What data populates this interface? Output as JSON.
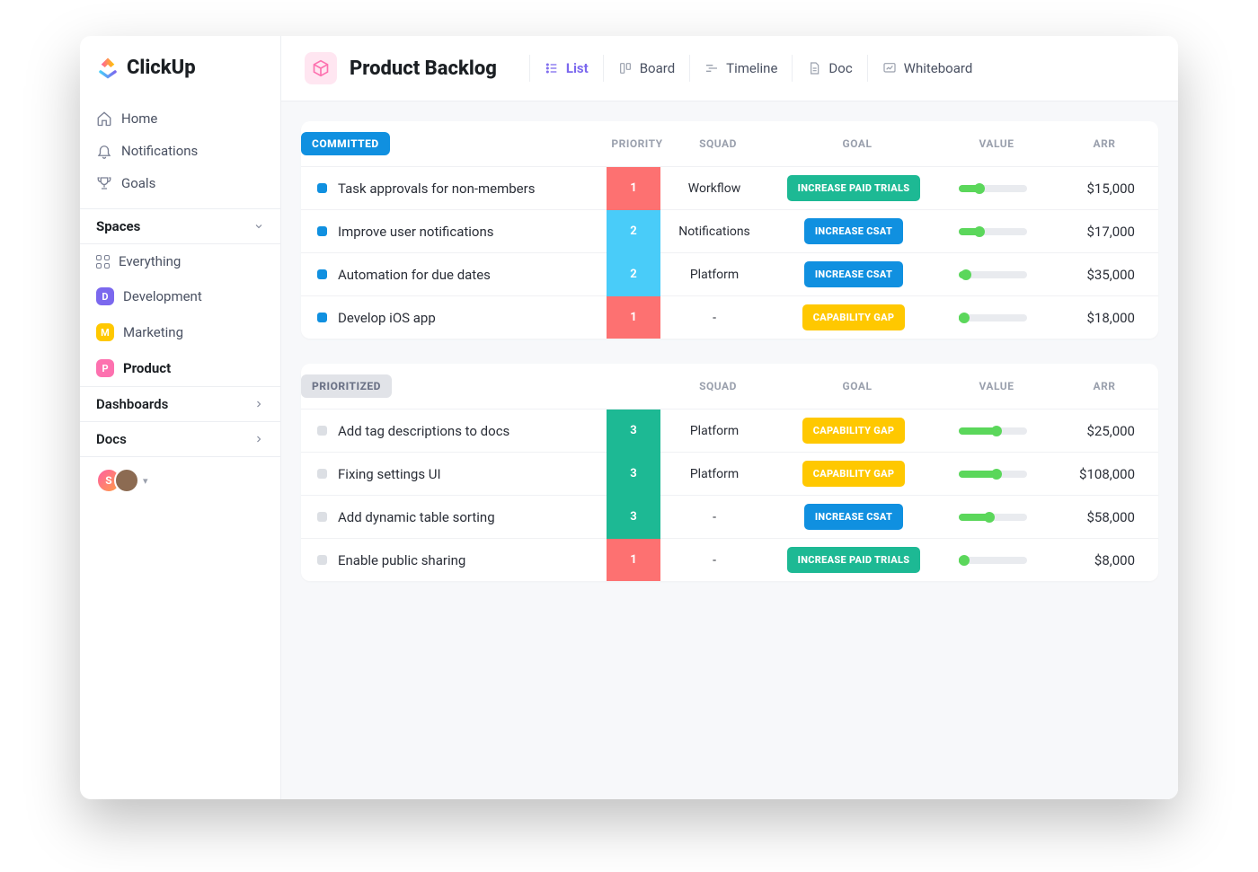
{
  "brand": "ClickUp",
  "sidebar": {
    "nav": [
      {
        "icon": "home",
        "label": "Home"
      },
      {
        "icon": "bell",
        "label": "Notifications"
      },
      {
        "icon": "trophy",
        "label": "Goals"
      }
    ],
    "spaces_header": "Spaces",
    "everything": "Everything",
    "spaces": [
      {
        "letter": "D",
        "color": "#7b68ee",
        "label": "Development",
        "active": false
      },
      {
        "letter": "M",
        "color": "#ffc800",
        "label": "Marketing",
        "active": false
      },
      {
        "letter": "P",
        "color": "#fd71af",
        "label": "Product",
        "active": true
      }
    ],
    "dashboards": "Dashboards",
    "docs": "Docs",
    "avatars": [
      {
        "letter": "S",
        "bg": "linear-gradient(135deg,#ff5ea3,#ff9f46)"
      },
      {
        "letter": "",
        "bg": "#8c6b52"
      }
    ]
  },
  "header": {
    "page_title": "Product Backlog",
    "views": [
      {
        "icon": "list",
        "label": "List",
        "active": true
      },
      {
        "icon": "board",
        "label": "Board",
        "active": false
      },
      {
        "icon": "timeline",
        "label": "Timeline",
        "active": false
      },
      {
        "icon": "doc",
        "label": "Doc",
        "active": false
      },
      {
        "icon": "whiteboard",
        "label": "Whiteboard",
        "active": false
      }
    ]
  },
  "columns": {
    "priority": "PRIORITY",
    "squad": "SQUAD",
    "goal": "GOAL",
    "value": "VALUE",
    "arr": "ARR"
  },
  "priority_colors": {
    "1": "#fd7171",
    "2": "#49ccf9",
    "3": "#1db994"
  },
  "goal_colors": {
    "INCREASE PAID TRIALS": "#1db994",
    "INCREASE CSAT": "#1090e0",
    "CAPABILITY GAP": "#ffc800"
  },
  "groups": [
    {
      "name": "COMMITTED",
      "badge": "blue",
      "show_priority_header": true,
      "tasks": [
        {
          "marker": "#1090e0",
          "title": "Task approvals for non-members",
          "priority": "1",
          "squad": "Workflow",
          "goal": "INCREASE PAID TRIALS",
          "value": 30,
          "arr": "$15,000"
        },
        {
          "marker": "#1090e0",
          "title": "Improve  user notifications",
          "priority": "2",
          "squad": "Notifications",
          "goal": "INCREASE CSAT",
          "value": 30,
          "arr": "$17,000"
        },
        {
          "marker": "#1090e0",
          "title": "Automation for due dates",
          "priority": "2",
          "squad": "Platform",
          "goal": "INCREASE CSAT",
          "value": 10,
          "arr": "$35,000"
        },
        {
          "marker": "#1090e0",
          "title": "Develop iOS app",
          "priority": "1",
          "squad": "-",
          "goal": "CAPABILITY GAP",
          "value": 8,
          "arr": "$18,000"
        }
      ]
    },
    {
      "name": "PRIORITIZED",
      "badge": "gray",
      "show_priority_header": false,
      "tasks": [
        {
          "marker": "#dcdfe4",
          "title": "Add tag descriptions to docs",
          "priority": "3",
          "squad": "Platform",
          "goal": "CAPABILITY GAP",
          "value": 55,
          "arr": "$25,000"
        },
        {
          "marker": "#dcdfe4",
          "title": "Fixing settings UI",
          "priority": "3",
          "squad": "Platform",
          "goal": "CAPABILITY GAP",
          "value": 55,
          "arr": "$108,000"
        },
        {
          "marker": "#dcdfe4",
          "title": "Add dynamic table sorting",
          "priority": "3",
          "squad": "-",
          "goal": "INCREASE CSAT",
          "value": 45,
          "arr": "$58,000"
        },
        {
          "marker": "#dcdfe4",
          "title": "Enable public sharing",
          "priority": "1",
          "squad": "-",
          "goal": "INCREASE PAID TRIALS",
          "value": 8,
          "arr": "$8,000"
        }
      ]
    }
  ]
}
